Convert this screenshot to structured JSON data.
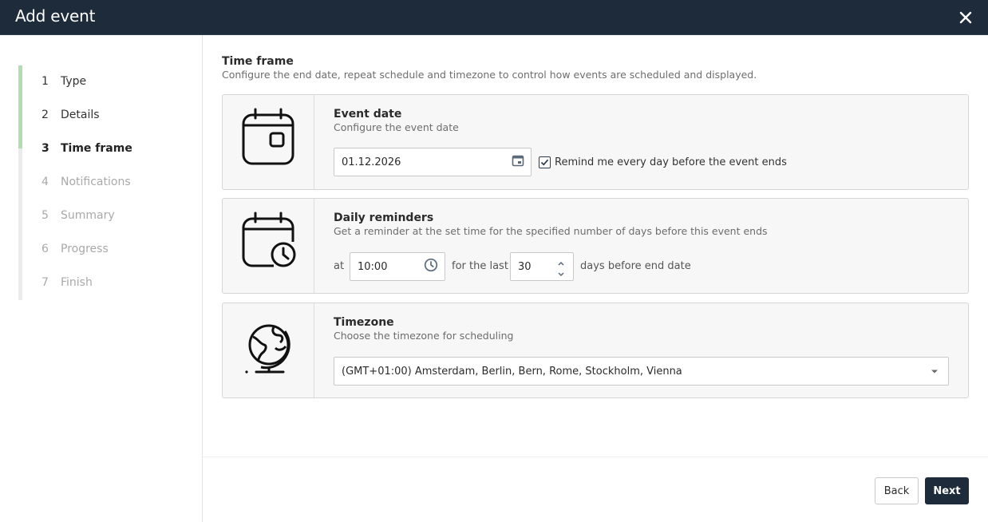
{
  "dialog": {
    "title": "Add event",
    "close_icon": "close-icon"
  },
  "steps": [
    {
      "number": "1",
      "label": "Type",
      "state": "done"
    },
    {
      "number": "2",
      "label": "Details",
      "state": "done"
    },
    {
      "number": "3",
      "label": "Time frame",
      "state": "active"
    },
    {
      "number": "4",
      "label": "Notifications",
      "state": "todo"
    },
    {
      "number": "5",
      "label": "Summary",
      "state": "todo"
    },
    {
      "number": "6",
      "label": "Progress",
      "state": "todo"
    },
    {
      "number": "7",
      "label": "Finish",
      "state": "todo"
    }
  ],
  "section": {
    "title": "Time frame",
    "subtitle": "Configure the end date, repeat schedule and timezone to control how events are scheduled and displayed."
  },
  "event_date": {
    "icon": "calendar-icon",
    "title": "Event date",
    "subtitle": "Configure the event date",
    "date_value": "01.12.2026",
    "remind_checked": true,
    "remind_label": "Remind me every day before the event ends"
  },
  "daily_reminders": {
    "icon": "calendar-clock-icon",
    "title": "Daily reminders",
    "subtitle": "Get a reminder at the set time for the specified number of days before this event ends",
    "at_label": "at",
    "time_value": "10:00",
    "for_label": "for the last",
    "days_value": "30",
    "days_suffix": "days before end date"
  },
  "timezone": {
    "icon": "globe-icon",
    "title": "Timezone",
    "subtitle": "Choose the timezone for scheduling",
    "selected": "(GMT+01:00) Amsterdam, Berlin, Bern, Rome, Stockholm, Vienna"
  },
  "footer": {
    "back_label": "Back",
    "next_label": "Next"
  },
  "colors": {
    "header_bg": "#1e2b3b",
    "progress": "#b3dcb3",
    "primary_button": "#1e2b3b"
  }
}
